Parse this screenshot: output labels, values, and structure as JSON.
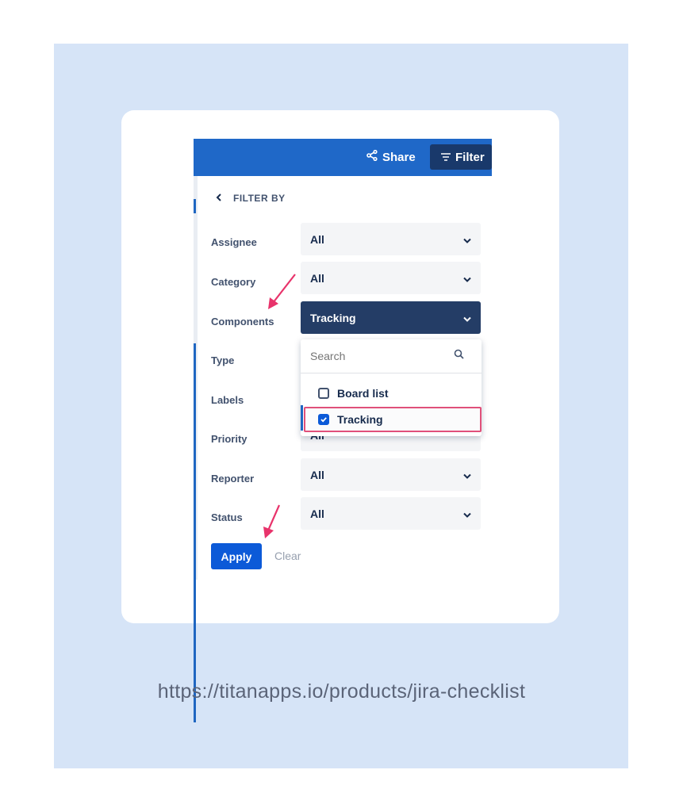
{
  "header": {
    "share_label": "Share",
    "filter_label": "Filter"
  },
  "panel": {
    "title": "FILTER BY",
    "rows": [
      {
        "label": "Assignee",
        "value": "All"
      },
      {
        "label": "Category",
        "value": "All"
      },
      {
        "label": "Components",
        "value": "Tracking"
      },
      {
        "label": "Type",
        "value": ""
      },
      {
        "label": "Labels",
        "value": ""
      },
      {
        "label": "Priority",
        "value": "All"
      },
      {
        "label": "Reporter",
        "value": "All"
      },
      {
        "label": "Status",
        "value": "All"
      }
    ],
    "dropdown": {
      "search_placeholder": "Search",
      "options": [
        {
          "label": "Board list",
          "checked": false
        },
        {
          "label": "Tracking",
          "checked": true
        }
      ]
    },
    "apply_label": "Apply",
    "clear_label": "Clear"
  },
  "footer": {
    "url_text": "https://titanapps.io/products/jira-checklist"
  },
  "colors": {
    "page_bg": "#d6e4f7",
    "topbar": "#1f68c8",
    "filter_button": "#19396b",
    "selected_select": "#243d66",
    "primary_button": "#0c5ad8",
    "highlight_border": "#e0507a",
    "annotation_arrow": "#e8336b"
  },
  "icons": [
    "share-icon",
    "filter-icon",
    "chevron-left-icon",
    "chevron-down-icon",
    "search-icon",
    "checkbox-icon",
    "arrow-annotation-icon"
  ]
}
